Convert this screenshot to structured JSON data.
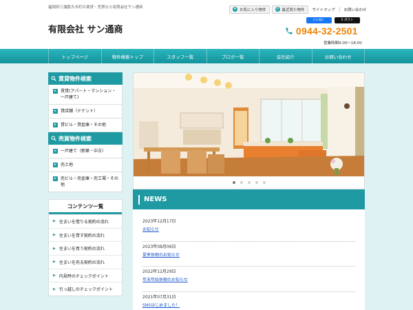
{
  "header": {
    "tagline": "福岡県三潴郡大木町の賃貸・売買なら有限会社サン通商",
    "company_name": "有限会社 サン通商",
    "phone": "0944-32-2501",
    "hours": "営業時間9:00～18:00",
    "top_links": {
      "favorites": "お気に入り物件",
      "recent": "最近見た物件",
      "sitemap": "サイトマップ",
      "contact": "お問い合わせ"
    },
    "sns": {
      "facebook": "いいね！",
      "twitter": "X ポスト"
    }
  },
  "nav": [
    "トップページ",
    "物件検索トップ",
    "スタッフ一覧",
    "ブログ一覧",
    "会社紹介",
    "お問い合わせ"
  ],
  "sidebar": {
    "rental": {
      "title": "賃貸物件検索",
      "items": [
        "賃貸(アパート・マンション・一戸建て)",
        "貸店舗（テナント）",
        "貸ビル・貸倉庫・その他"
      ]
    },
    "sale": {
      "title": "売買物件検索",
      "items": [
        "一戸建て（新築・中古）",
        "売土地",
        "売ビル・売倉庫・売工場・その他"
      ]
    },
    "contents": {
      "title": "コンテンツ一覧",
      "items": [
        "住まいを借りる契約の流れ",
        "住まいを貸す契約の流れ",
        "住まいを買う契約の流れ",
        "住まいを売る契約の流れ",
        "内見時のチェックポイント",
        "引っ越しのチェックポイント"
      ]
    }
  },
  "slider": {
    "slide_count": 5,
    "active_index": 0
  },
  "news": {
    "title": "NEWS",
    "items": [
      {
        "date": "2023年12月17日",
        "title": "お知らせ"
      },
      {
        "date": "2023年08月06日",
        "title": "夏季休暇のお知らせ"
      },
      {
        "date": "2022年12月29日",
        "title": "年末年始休暇のお知らせ"
      },
      {
        "date": "2021年07月31日",
        "title": "SNSはじめました！"
      }
    ]
  },
  "colors": {
    "accent": "#1f9aa3",
    "phone": "#f08200",
    "link": "#1a56c8",
    "band": "#dff2f3"
  }
}
